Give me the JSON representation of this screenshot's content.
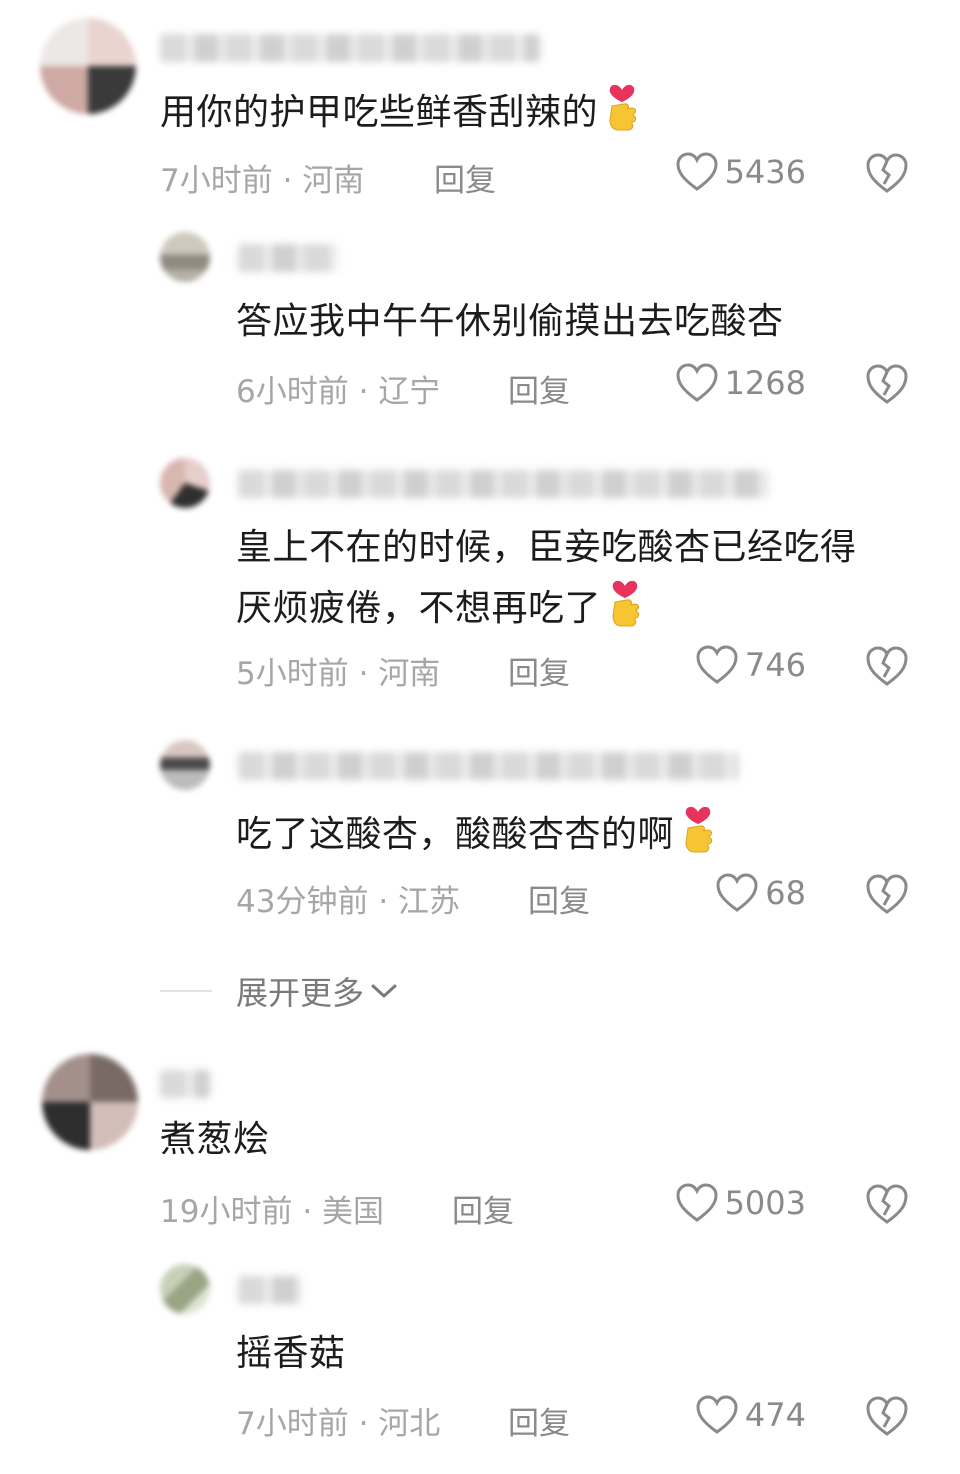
{
  "comments": [
    {
      "text": "用你的护甲吃些鲜香刮辣的",
      "time": "7小时前",
      "region": "河南",
      "reply_label": "回复",
      "likes": "5436",
      "has_emoji": true
    },
    {
      "text": "答应我中午午休别偷摸出去吃酸杏",
      "time": "6小时前",
      "region": "辽宁",
      "reply_label": "回复",
      "likes": "1268",
      "has_emoji": false
    },
    {
      "text": "皇上不在的时候，臣妾吃酸杏已经吃得\n厌烦疲倦，不想再吃了",
      "time": "5小时前",
      "region": "河南",
      "reply_label": "回复",
      "likes": "746",
      "has_emoji": true
    },
    {
      "text": "吃了这酸杏，酸酸杏杏的啊",
      "time": "43分钟前",
      "region": "江苏",
      "reply_label": "回复",
      "likes": "68",
      "has_emoji": true
    },
    {
      "text": "煮葱烩",
      "time": "19小时前",
      "region": "美国",
      "reply_label": "回复",
      "likes": "5003",
      "has_emoji": false
    },
    {
      "text": "摇香菇",
      "time": "7小时前",
      "region": "河北",
      "reply_label": "回复",
      "likes": "474",
      "has_emoji": false
    }
  ],
  "separator": "·",
  "expand_more": "展开更多",
  "colors": {
    "text": "#1c1c1c",
    "meta": "#a6a6a6",
    "action": "#8a8a8a",
    "emoji_heart": "#e8335d",
    "emoji_hand": "#f7c531"
  },
  "icons": {
    "like": "heart-outline-icon",
    "dislike": "broken-heart-icon",
    "emoji": "finger-heart-emoji",
    "expand": "chevron-down-icon"
  }
}
